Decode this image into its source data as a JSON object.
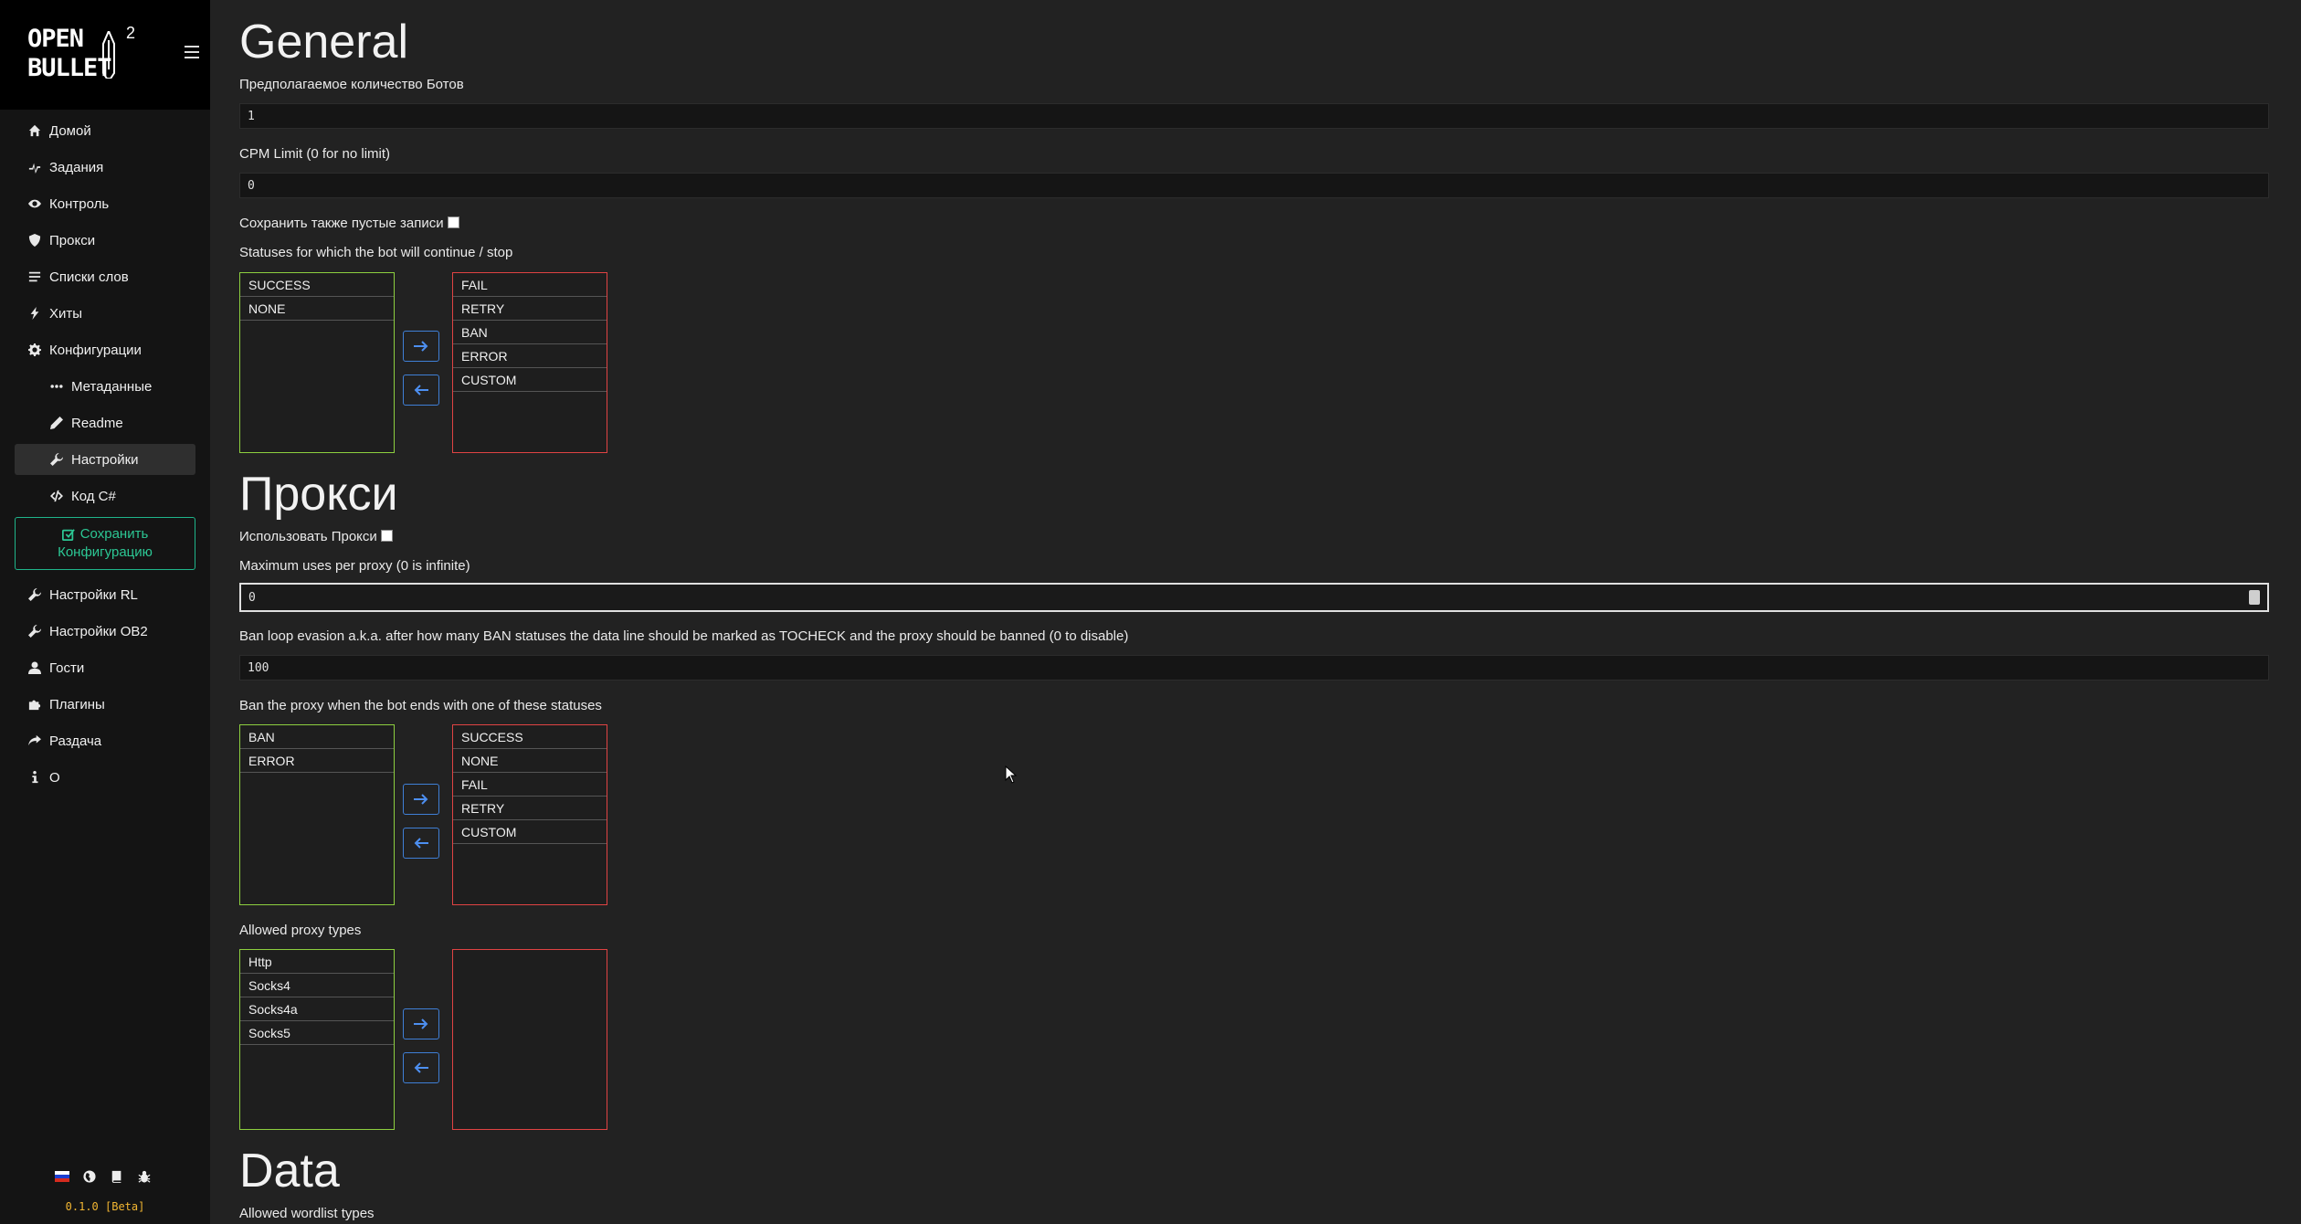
{
  "app": {
    "logo_line1": "OPEN",
    "logo_line2": "BULLET",
    "logo_version_mark": "2",
    "version": "0.1.0 [Beta]"
  },
  "sidebar": {
    "items": [
      {
        "label": "Домой",
        "icon": "home-icon"
      },
      {
        "label": "Задания",
        "icon": "jobs-icon"
      },
      {
        "label": "Контроль",
        "icon": "eye-icon"
      },
      {
        "label": "Прокси",
        "icon": "shield-icon"
      },
      {
        "label": "Списки слов",
        "icon": "list-icon"
      },
      {
        "label": "Хиты",
        "icon": "bolt-icon"
      },
      {
        "label": "Конфигурации",
        "icon": "gear-icon"
      },
      {
        "label": "Метаданные",
        "icon": "dots-icon",
        "sub": true
      },
      {
        "label": "Readme",
        "icon": "pencil-icon",
        "sub": true
      },
      {
        "label": "Настройки",
        "icon": "wrench-icon",
        "sub": true,
        "active": true
      },
      {
        "label": "Код C#",
        "icon": "code-icon",
        "sub": true
      }
    ],
    "save_line1": "Сохранить",
    "save_line2": "Конфигурацию",
    "items_after": [
      {
        "label": "Настройки RL",
        "icon": "wrench-icon"
      },
      {
        "label": "Настройки OB2",
        "icon": "wrench-icon"
      },
      {
        "label": "Гости",
        "icon": "user-icon"
      },
      {
        "label": "Плагины",
        "icon": "puzzle-icon"
      },
      {
        "label": "Раздача",
        "icon": "share-icon"
      },
      {
        "label": "О",
        "icon": "info-icon"
      }
    ],
    "footer_icons": [
      "russia-flag-icon",
      "globe-icon",
      "book-icon",
      "bug-icon"
    ]
  },
  "general": {
    "title": "General",
    "bots_label": "Предполагаемое количество Ботов",
    "bots_value": "1",
    "cpm_label": "CPM Limit (0 for no limit)",
    "cpm_value": "0",
    "save_empty_label": "Сохранить также пустые записи",
    "statuses_label": "Statuses for which the bot will continue / stop",
    "continue_list": [
      "SUCCESS",
      "NONE"
    ],
    "stop_list": [
      "FAIL",
      "RETRY",
      "BAN",
      "ERROR",
      "CUSTOM"
    ]
  },
  "proxy": {
    "title": "Прокси",
    "use_proxy_label": "Использовать Прокси",
    "max_uses_label": "Maximum uses per proxy (0 is infinite)",
    "max_uses_value": "0",
    "ban_loop_label": "Ban loop evasion a.k.a. after how many BAN statuses the data line should be marked as TOCHECK and the proxy should be banned (0 to disable)",
    "ban_loop_value": "100",
    "ban_statuses_label": "Ban the proxy when the bot ends with one of these statuses",
    "ban_list": [
      "BAN",
      "ERROR"
    ],
    "noban_list": [
      "SUCCESS",
      "NONE",
      "FAIL",
      "RETRY",
      "CUSTOM"
    ],
    "types_label": "Allowed proxy types",
    "allowed_types": [
      "Http",
      "Socks4",
      "Socks4a",
      "Socks5"
    ],
    "disallowed_types": []
  },
  "data": {
    "title": "Data",
    "wordlist_label": "Allowed wordlist types"
  },
  "colors": {
    "accent_green": "#8dcf3f",
    "accent_red": "#e04343",
    "accent_blue": "#3f7fd6",
    "save_teal": "#2cc794",
    "version_yellow": "#f2b632"
  }
}
